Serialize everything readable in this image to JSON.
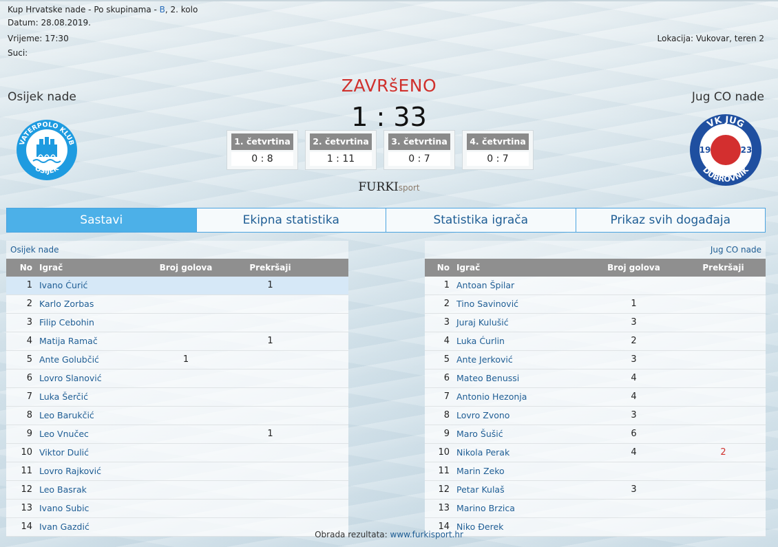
{
  "match": {
    "competition": "Kup Hrvatske nade - Po skupinama - ",
    "group": "B",
    "round": ", 2. kolo",
    "date": "Datum: 28.08.2019.",
    "time": "Vrijeme: 17:30",
    "referees": "Suci:",
    "location": "Lokacija: Vukovar, teren 2",
    "status": "ZAVRšENO",
    "score": "1 : 33",
    "home_team": "Osijek nade",
    "away_team": "Jug CO nade"
  },
  "home_logo": {
    "ring_text": "VATERPOLO KLUB",
    "city": "OSIJEK",
    "color": "#1e9be0"
  },
  "away_logo": {
    "top": "VK JUG",
    "bottom": "DUBROVNIK",
    "left_num": "19",
    "right_num": "23",
    "ring_color": "#1f4fa0",
    "ball_color": "#d32f2f"
  },
  "quarters": [
    {
      "label": "1. četvrtina",
      "score": "0 : 8"
    },
    {
      "label": "2. četvrtina",
      "score": "1 : 11"
    },
    {
      "label": "3. četvrtina",
      "score": "0 : 7"
    },
    {
      "label": "4. četvrtina",
      "score": "0 : 7"
    }
  ],
  "brand": {
    "main": "FURKI",
    "suffix": "sport"
  },
  "tabs": [
    "Sastavi",
    "Ekipna statistika",
    "Statistika igrača",
    "Prikaz svih događaja"
  ],
  "columns": {
    "no": "No",
    "player": "Igrač",
    "goals": "Broj golova",
    "fouls": "Prekršaji"
  },
  "home_roster": [
    {
      "no": "1",
      "name": "Ivano Ćurić",
      "goals": "",
      "fouls": "1"
    },
    {
      "no": "2",
      "name": "Karlo Zorbas",
      "goals": "",
      "fouls": ""
    },
    {
      "no": "3",
      "name": "Filip Cebohin",
      "goals": "",
      "fouls": ""
    },
    {
      "no": "4",
      "name": "Matija Ramač",
      "goals": "",
      "fouls": "1"
    },
    {
      "no": "5",
      "name": "Ante Golubčić",
      "goals": "1",
      "fouls": ""
    },
    {
      "no": "6",
      "name": "Lovro Slanović",
      "goals": "",
      "fouls": ""
    },
    {
      "no": "7",
      "name": "Luka Šerčić",
      "goals": "",
      "fouls": ""
    },
    {
      "no": "8",
      "name": "Leo Barukčić",
      "goals": "",
      "fouls": ""
    },
    {
      "no": "9",
      "name": "Leo Vnučec",
      "goals": "",
      "fouls": "1"
    },
    {
      "no": "10",
      "name": "Viktor Dulić",
      "goals": "",
      "fouls": ""
    },
    {
      "no": "11",
      "name": "Lovro Rajković",
      "goals": "",
      "fouls": ""
    },
    {
      "no": "12",
      "name": "Leo Basrak",
      "goals": "",
      "fouls": ""
    },
    {
      "no": "13",
      "name": "Ivano Subic",
      "goals": "",
      "fouls": ""
    },
    {
      "no": "14",
      "name": "Ivan Gazdić",
      "goals": "",
      "fouls": ""
    }
  ],
  "away_roster": [
    {
      "no": "1",
      "name": "Antoan Špilar",
      "goals": "",
      "fouls": ""
    },
    {
      "no": "2",
      "name": "Tino Savinović",
      "goals": "1",
      "fouls": ""
    },
    {
      "no": "3",
      "name": "Juraj Kulušić",
      "goals": "3",
      "fouls": ""
    },
    {
      "no": "4",
      "name": "Luka Ćurlin",
      "goals": "2",
      "fouls": ""
    },
    {
      "no": "5",
      "name": "Ante Jerković",
      "goals": "3",
      "fouls": ""
    },
    {
      "no": "6",
      "name": "Mateo Benussi",
      "goals": "4",
      "fouls": ""
    },
    {
      "no": "7",
      "name": "Antonio Hezonja",
      "goals": "4",
      "fouls": ""
    },
    {
      "no": "8",
      "name": "Lovro Zvono",
      "goals": "3",
      "fouls": ""
    },
    {
      "no": "9",
      "name": "Maro Šušić",
      "goals": "6",
      "fouls": ""
    },
    {
      "no": "10",
      "name": "Nikola Perak",
      "goals": "4",
      "fouls": "2"
    },
    {
      "no": "11",
      "name": "Marin Zeko",
      "goals": "",
      "fouls": ""
    },
    {
      "no": "12",
      "name": "Petar Kulaš",
      "goals": "3",
      "fouls": ""
    },
    {
      "no": "13",
      "name": "Marino Brzica",
      "goals": "",
      "fouls": ""
    },
    {
      "no": "14",
      "name": "Niko Đerek",
      "goals": "",
      "fouls": ""
    }
  ],
  "footer": {
    "label": "Obrada rezultata: ",
    "link": "www.furkisport.hr"
  }
}
